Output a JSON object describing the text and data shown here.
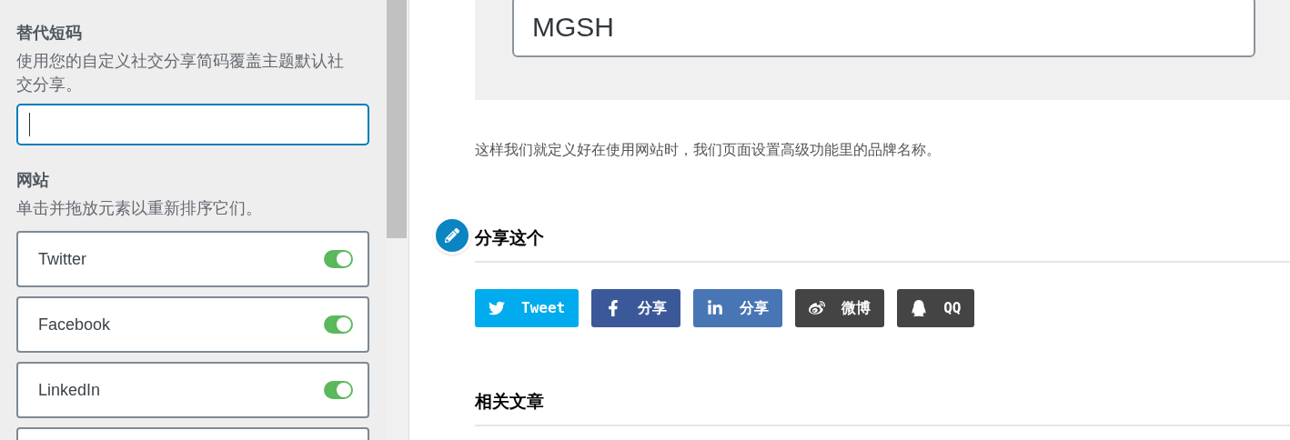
{
  "sidebar": {
    "shortcode": {
      "title": "替代短码",
      "description": "使用您的自定义社交分享简码覆盖主题默认社交分享。"
    },
    "sites": {
      "title": "网站",
      "description": "单击并拖放元素以重新排序它们。",
      "items": [
        {
          "label": "Twitter",
          "on": true
        },
        {
          "label": "Facebook",
          "on": true
        },
        {
          "label": "LinkedIn",
          "on": true
        }
      ]
    }
  },
  "content": {
    "brand_field": {
      "value": "MGSH"
    },
    "paragraph": "这样我们就定义好在使用网站时，我们页面设置高级功能里的品牌名称。",
    "share": {
      "title": "分享这个",
      "buttons": [
        {
          "kind": "twitter",
          "label": "Tweet",
          "color": "#00aced"
        },
        {
          "kind": "facebook",
          "label": "分享",
          "color": "#3b5998"
        },
        {
          "kind": "linkedin",
          "label": "分享",
          "color": "#4875b4"
        },
        {
          "kind": "weibo",
          "label": "微博",
          "color": "#444444"
        },
        {
          "kind": "qq",
          "label": "QQ",
          "color": "#444444"
        }
      ]
    },
    "related": {
      "title": "相关文章"
    }
  }
}
